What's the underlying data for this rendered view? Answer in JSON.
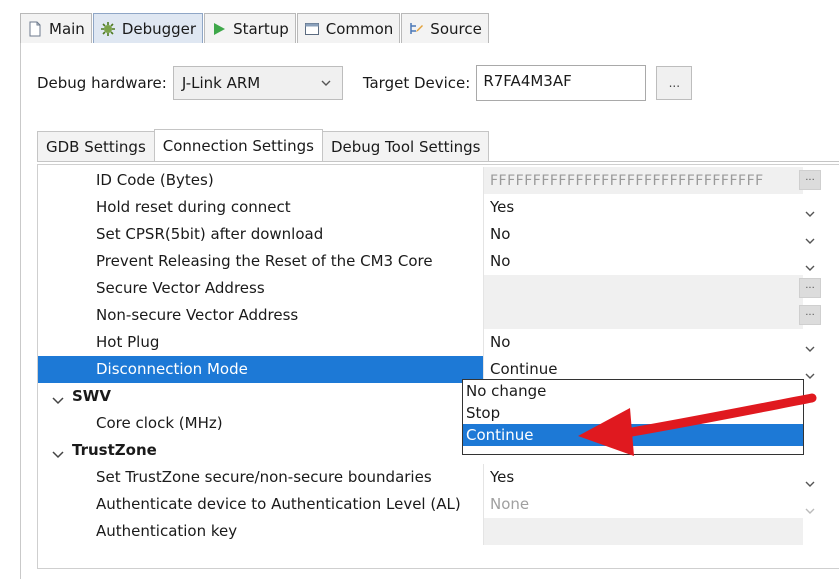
{
  "top_tabs": [
    {
      "label": "Main",
      "icon": "document-icon"
    },
    {
      "label": "Debugger",
      "icon": "bug-gear-icon",
      "active": true
    },
    {
      "label": "Startup",
      "icon": "play-icon"
    },
    {
      "label": "Common",
      "icon": "window-icon"
    },
    {
      "label": "Source",
      "icon": "source-lookup-icon"
    }
  ],
  "debug_hardware": {
    "label": "Debug hardware:",
    "value": "J-Link ARM"
  },
  "target_device": {
    "label": "Target Device:",
    "value": "R7FA4M3AF",
    "browse_label": "..."
  },
  "inner_tabs": [
    {
      "label": "GDB Settings"
    },
    {
      "label": "Connection Settings",
      "active": true
    },
    {
      "label": "Debug Tool Settings"
    }
  ],
  "rows": {
    "id_code": {
      "name": "ID Code (Bytes)",
      "value": "FFFFFFFFFFFFFFFFFFFFFFFFFFFFFFFF"
    },
    "hold_reset": {
      "name": "Hold reset during connect",
      "value": "Yes"
    },
    "set_cpsr": {
      "name": "Set CPSR(5bit) after download",
      "value": "No"
    },
    "prevent_release": {
      "name": "Prevent Releasing the Reset of the CM3 Core",
      "value": "No"
    },
    "secure_vector": {
      "name": "Secure Vector Address",
      "value": ""
    },
    "nonsecure_vector": {
      "name": "Non-secure Vector Address",
      "value": ""
    },
    "hot_plug": {
      "name": "Hot Plug",
      "value": "No"
    },
    "disconnection_mode": {
      "name": "Disconnection Mode",
      "value": "Continue"
    },
    "swv_group": {
      "name": "SWV"
    },
    "core_clock": {
      "name": "Core clock (MHz)",
      "value": ""
    },
    "trustzone_group": {
      "name": "TrustZone"
    },
    "tz_boundaries": {
      "name": "Set TrustZone secure/non-secure boundaries",
      "value": "Yes"
    },
    "auth_level": {
      "name": "Authenticate device to Authentication Level (AL)",
      "value": "None"
    },
    "auth_key": {
      "name": "Authentication key",
      "value": ""
    }
  },
  "dropdown_options": [
    "No change",
    "Stop",
    "Continue"
  ],
  "dropdown_selected": "Continue",
  "colors": {
    "selection": "#1d79d6",
    "annotation_arrow": "#e0191f",
    "tab_active": "#dfe7f2"
  }
}
